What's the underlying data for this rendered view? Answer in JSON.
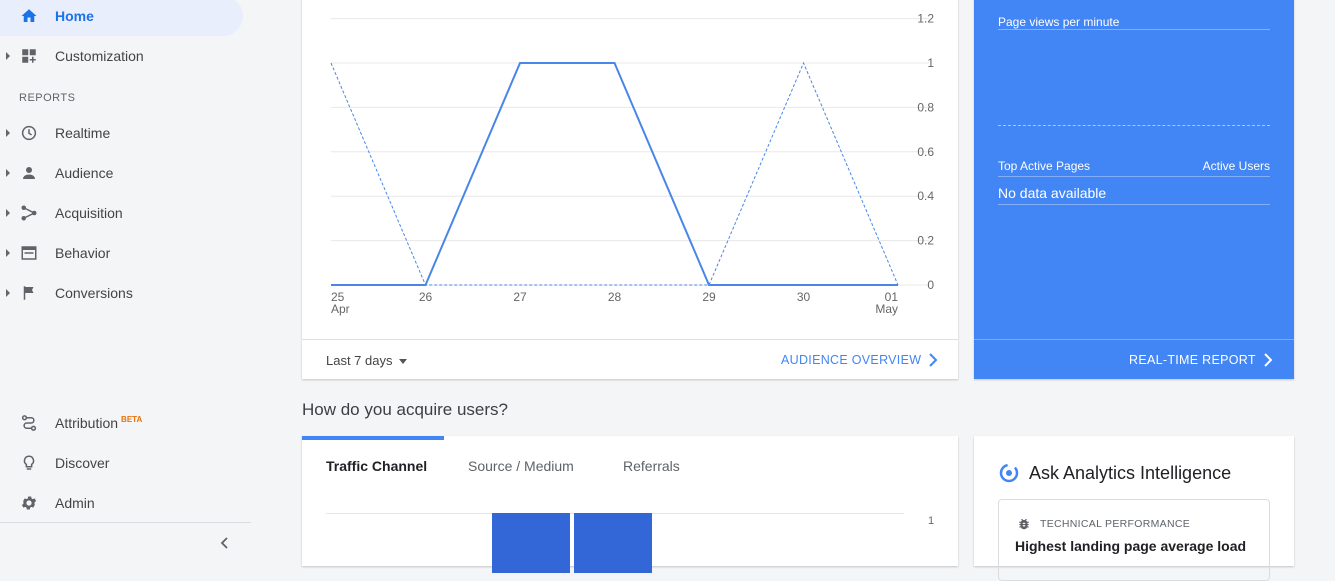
{
  "sidebar": {
    "home": "Home",
    "customization": "Customization",
    "reports_header": "REPORTS",
    "realtime": "Realtime",
    "audience": "Audience",
    "acquisition": "Acquisition",
    "behavior": "Behavior",
    "conversions": "Conversions",
    "attribution": "Attribution",
    "attribution_badge": "BETA",
    "discover": "Discover",
    "admin": "Admin"
  },
  "overview_card": {
    "date_range": "Last 7 days",
    "link_label": "AUDIENCE OVERVIEW"
  },
  "chart_data": {
    "type": "line",
    "x": [
      "25 Apr",
      "26",
      "27",
      "28",
      "29",
      "30",
      "01 May"
    ],
    "x_tick_top": [
      "25",
      "26",
      "27",
      "28",
      "29",
      "30",
      "01"
    ],
    "x_tick_bottom": [
      "Apr",
      "",
      "",
      "",
      "",
      "",
      "May"
    ],
    "y_ticks": [
      "1.2",
      "1",
      "0.8",
      "0.6",
      "0.4",
      "0.2",
      "0"
    ],
    "ylim": [
      0,
      1.2
    ],
    "series": [
      {
        "style": "solid",
        "values": [
          0,
          0,
          1,
          1,
          0,
          0,
          0
        ]
      },
      {
        "style": "dashed",
        "values": [
          1,
          0,
          0,
          0,
          0,
          1,
          0
        ]
      }
    ],
    "grid": true
  },
  "realtime_card": {
    "page_views_label": "Page views per minute",
    "top_pages_label": "Top Active Pages",
    "active_users_label": "Active Users",
    "no_data": "No data available",
    "link_label": "REAL-TIME REPORT"
  },
  "acquire": {
    "title": "How do you acquire users?",
    "tabs": [
      "Traffic Channel",
      "Source / Medium",
      "Referrals"
    ],
    "y_tick": "1"
  },
  "ai_card": {
    "title": "Ask Analytics Intelligence",
    "category": "TECHNICAL PERFORMANCE",
    "headline": "Highest landing page average load"
  },
  "colors": {
    "accent": "#4285f4",
    "series_solid": "#4a86e8",
    "bar": "#3366d6"
  }
}
